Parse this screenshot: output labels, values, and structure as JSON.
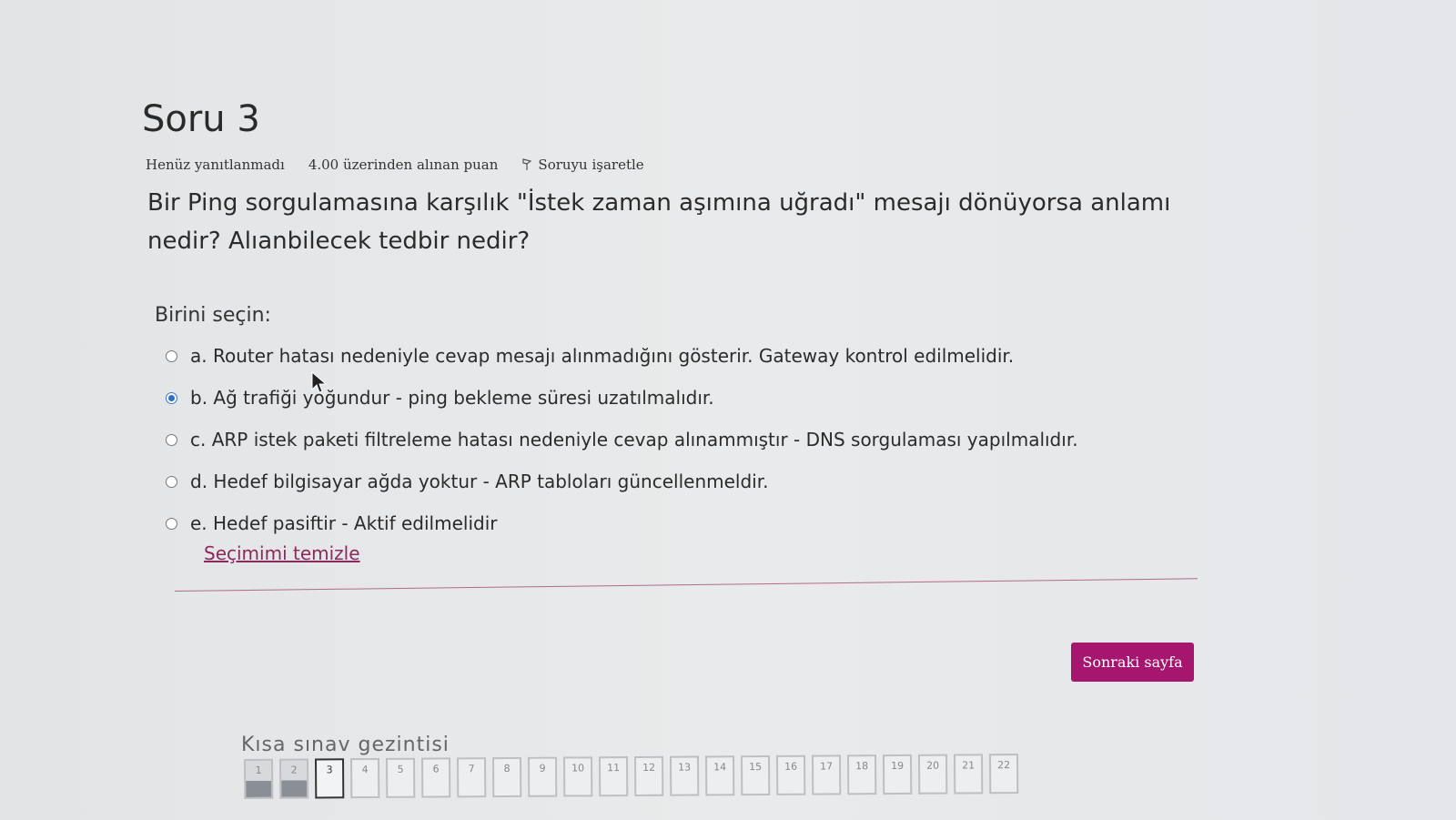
{
  "question": {
    "title": "Soru 3",
    "status": "Henüz yanıtlanmadı",
    "points": "4.00 üzerinden alınan puan",
    "flag_label": "Soruyu işaretle",
    "text": "Bir Ping sorgulamasına karşılık \"İstek zaman aşımına uğradı\" mesajı dönüyorsa anlamı nedir? Alıanbilecek tedbir nedir?",
    "prompt": "Birini seçin:"
  },
  "answers": [
    {
      "label": "a. Router hatası nedeniyle cevap mesajı alınmadığını gösterir. Gateway kontrol edilmelidir.",
      "selected": false
    },
    {
      "label": "b. Ağ trafiği yoğundur - ping bekleme süresi uzatılmalıdır.",
      "selected": true
    },
    {
      "label": "c. ARP istek paketi filtreleme hatası nedeniyle cevap alınammıştır - DNS sorgulaması yapılmalıdır.",
      "selected": false
    },
    {
      "label": "d. Hedef bilgisayar ağda yoktur - ARP tabloları güncellenmeldir.",
      "selected": false
    },
    {
      "label": "e. Hedef pasiftir - Aktif edilmelidir",
      "selected": false
    }
  ],
  "clear_label": "Seçimimi temizle",
  "next_label": "Sonraki sayfa",
  "nav": {
    "title": "Kısa sınav gezintisi",
    "items": [
      {
        "n": "1",
        "state": "answered"
      },
      {
        "n": "2",
        "state": "answered"
      },
      {
        "n": "3",
        "state": "current"
      },
      {
        "n": "4",
        "state": ""
      },
      {
        "n": "5",
        "state": ""
      },
      {
        "n": "6",
        "state": ""
      },
      {
        "n": "7",
        "state": ""
      },
      {
        "n": "8",
        "state": ""
      },
      {
        "n": "9",
        "state": ""
      },
      {
        "n": "10",
        "state": ""
      },
      {
        "n": "11",
        "state": ""
      },
      {
        "n": "12",
        "state": ""
      },
      {
        "n": "13",
        "state": ""
      },
      {
        "n": "14",
        "state": ""
      },
      {
        "n": "15",
        "state": ""
      },
      {
        "n": "16",
        "state": ""
      },
      {
        "n": "17",
        "state": ""
      },
      {
        "n": "18",
        "state": ""
      },
      {
        "n": "19",
        "state": ""
      },
      {
        "n": "20",
        "state": ""
      },
      {
        "n": "21",
        "state": ""
      },
      {
        "n": "22",
        "state": ""
      }
    ]
  },
  "colors": {
    "accent": "#a6166f",
    "link": "#8a2a5c",
    "radio_selected": "#2f6fc6"
  }
}
